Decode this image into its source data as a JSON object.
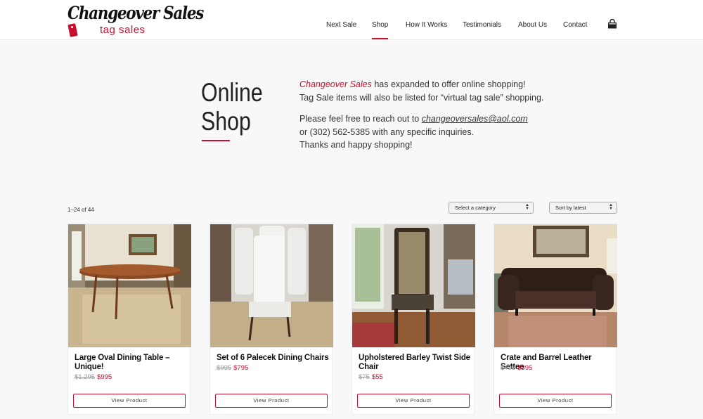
{
  "logo": {
    "script": "Changeover Sales",
    "sub": "tag sales"
  },
  "nav": {
    "items": [
      {
        "label": "Next Sale"
      },
      {
        "label": "Shop"
      },
      {
        "label": "How It Works"
      },
      {
        "label": "Testimonials"
      },
      {
        "label": "About Us"
      },
      {
        "label": "Contact"
      }
    ],
    "active": "Shop",
    "cart_icon": "shopping-bag-icon"
  },
  "intro": {
    "title_line1": "Online",
    "title_line2": "Shop",
    "brand": "Changeover Sales",
    "line1_rest": " has expanded to offer online shopping!",
    "line2": "Tag Sale items will also be listed for “virtual tag sale” shopping.",
    "contact_prefix": "Please feel free to reach out to ",
    "email": "changeoversales@aol.com",
    "contact_line2": "or (302) 562-5385 with any specific inquiries.",
    "contact_line3": "Thanks and happy shopping!"
  },
  "toolbar": {
    "result_count": "1–24 of 44",
    "category_select": "Select a category",
    "sort_select": "Sort by latest"
  },
  "products": [
    {
      "name": "Large Oval Dining Table – Unique!",
      "old_price": "$1,295",
      "new_price": "$995",
      "button": "View Product"
    },
    {
      "name": "Set of 6 Palecek Dining Chairs",
      "old_price": "$995",
      "new_price": "$795",
      "button": "View Product"
    },
    {
      "name": "Upholstered Barley Twist Side Chair",
      "old_price": "$75",
      "new_price": "$55",
      "button": "View Product"
    },
    {
      "name": "Crate and Barrel Leather Settee",
      "old_price": "$495",
      "new_price": "$395",
      "button": "View Product"
    }
  ],
  "colors": {
    "accent": "#c8102e",
    "background": "#f8f8f8",
    "old_price": "#999999"
  }
}
